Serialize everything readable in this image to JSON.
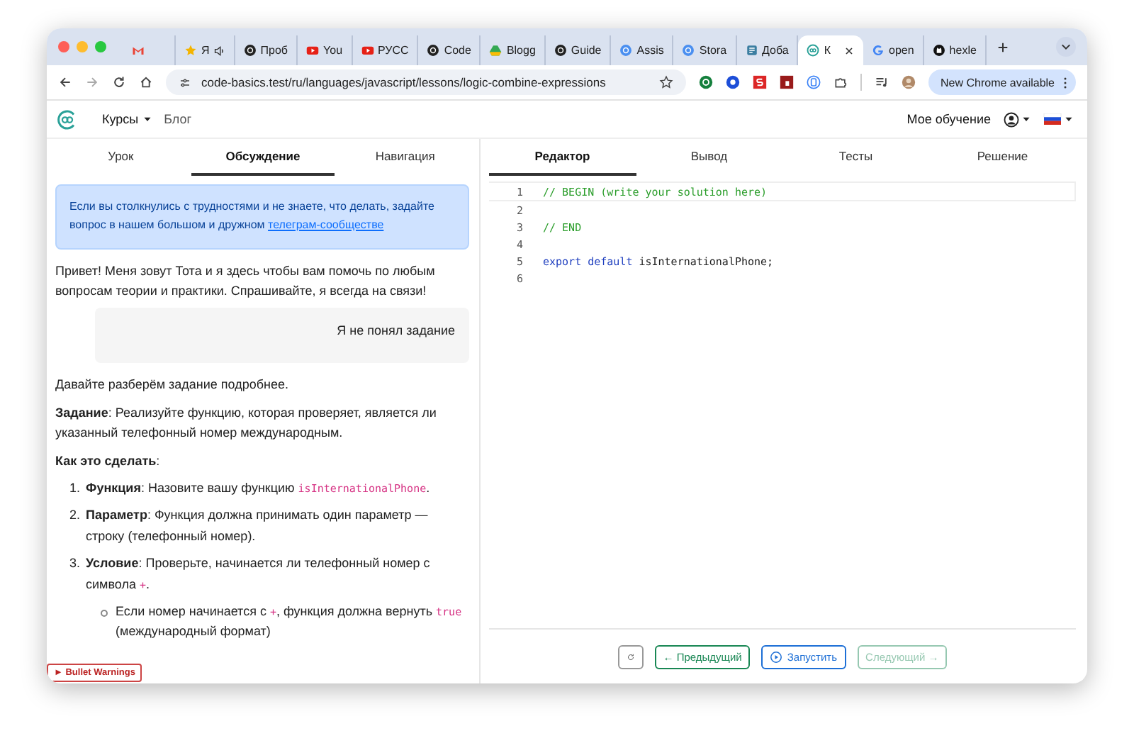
{
  "browser": {
    "tabs": [
      {
        "kind": "gmail",
        "selected": false
      },
      {
        "kind": "star",
        "title": "Я",
        "audio": true,
        "selected": false
      },
      {
        "kind": "dark",
        "title": "Проб",
        "selected": false
      },
      {
        "kind": "play",
        "title": "You",
        "selected": false
      },
      {
        "kind": "play",
        "title": "РУСС",
        "selected": false
      },
      {
        "kind": "dark",
        "title": "Code",
        "selected": false
      },
      {
        "kind": "drive",
        "title": "Blogg",
        "selected": false
      },
      {
        "kind": "dark",
        "title": "Guide",
        "selected": false
      },
      {
        "kind": "blue",
        "title": "Assis",
        "selected": false
      },
      {
        "kind": "blue",
        "title": "Stora",
        "selected": false
      },
      {
        "kind": "note",
        "title": "Доба",
        "selected": false
      },
      {
        "kind": "logo",
        "title": "К",
        "selected": true
      },
      {
        "kind": "google",
        "title": "open",
        "selected": false
      },
      {
        "kind": "github",
        "title": "hexle",
        "selected": false
      }
    ],
    "url": "code-basics.test/ru/languages/javascript/lessons/logic-combine-expressions",
    "update_button": "New Chrome available"
  },
  "header": {
    "nav": [
      {
        "label": "Курсы",
        "dropdown": true
      },
      {
        "label": "Блог",
        "dropdown": false
      }
    ],
    "my_learning": "Мое обучение"
  },
  "left_tabs": [
    {
      "label": "Урок",
      "selected": false
    },
    {
      "label": "Обсуждение",
      "selected": true
    },
    {
      "label": "Навигация",
      "selected": false
    }
  ],
  "notice": {
    "text": "Если вы столкнулись с трудностями и не знаете, что делать, задайте вопрос в нашем большом и дружном",
    "link": "телеграм-сообществе"
  },
  "greeting": "Привет! Меня зовут Тота и я здесь чтобы вам помочь по любым вопросам теории и практики. Спрашивайте, я всегда на связи!",
  "user_message": "Я не понял задание",
  "answer": [
    {
      "kind": "para",
      "parts": [
        {
          "kind": "text",
          "text": "Давайте разберём задание подробнее."
        }
      ]
    },
    {
      "kind": "para",
      "parts": [
        {
          "kind": "bold",
          "text": "Задание"
        },
        {
          "kind": "text",
          "text": ": Реализуйте функцию, которая проверяет, является ли указанный телефонный номер международным."
        }
      ]
    },
    {
      "kind": "para",
      "parts": [
        {
          "kind": "bold",
          "text": "Как это сделать"
        },
        {
          "kind": "text",
          "text": ":"
        }
      ]
    },
    {
      "kind": "list",
      "items": [
        {
          "number": "1.",
          "parts": [
            {
              "kind": "bold",
              "text": "Функция"
            },
            {
              "kind": "text",
              "text": ": Назовите вашу функцию "
            },
            {
              "kind": "code",
              "text": "isInternationalPhone"
            },
            {
              "kind": "text",
              "text": "."
            }
          ]
        },
        {
          "number": "2.",
          "parts": [
            {
              "kind": "bold",
              "text": "Параметр"
            },
            {
              "kind": "text",
              "text": ": Функция должна принимать один параметр — строку (телефонный номер)."
            }
          ]
        },
        {
          "number": "3.",
          "parts": [
            {
              "kind": "bold",
              "text": "Условие"
            },
            {
              "kind": "text",
              "text": ": Проверьте, начинается ли телефонный номер с символа "
            },
            {
              "kind": "code",
              "text": "+"
            },
            {
              "kind": "text",
              "text": "."
            }
          ],
          "children": [
            {
              "parts": [
                {
                  "kind": "text",
                  "text": "Если номер начинается с "
                },
                {
                  "kind": "code",
                  "text": "+"
                },
                {
                  "kind": "text",
                  "text": ", функция должна вернуть "
                },
                {
                  "kind": "code",
                  "text": "true"
                },
                {
                  "kind": "text",
                  "text": " (международный формат)"
                }
              ]
            }
          ]
        }
      ]
    }
  ],
  "warning_badge": "► Bullet Warnings",
  "right_tabs": [
    {
      "label": "Редактор",
      "selected": true
    },
    {
      "label": "Вывод",
      "selected": false
    },
    {
      "label": "Тесты",
      "selected": false
    },
    {
      "label": "Решение",
      "selected": false
    }
  ],
  "code": [
    {
      "number": "1",
      "tokens": [
        {
          "kind": "comment",
          "text": "// BEGIN (write your solution here)"
        }
      ]
    },
    {
      "number": "2"
    },
    {
      "number": "3",
      "tokens": [
        {
          "kind": "comment",
          "text": "// END"
        }
      ]
    },
    {
      "number": "4"
    },
    {
      "number": "5",
      "tokens": [
        {
          "kind": "keyword",
          "text": "export default"
        },
        {
          "kind": "plain",
          "text": " isInternationalPhone;"
        }
      ]
    },
    {
      "number": "6"
    }
  ],
  "actions": [
    {
      "kind": "reset"
    },
    {
      "kind": "prev",
      "label": "← Предыдущий",
      "disabled": false
    },
    {
      "kind": "run",
      "label": "Запустить",
      "disabled": false
    },
    {
      "kind": "next",
      "label": "Следующий →",
      "disabled": true
    }
  ]
}
